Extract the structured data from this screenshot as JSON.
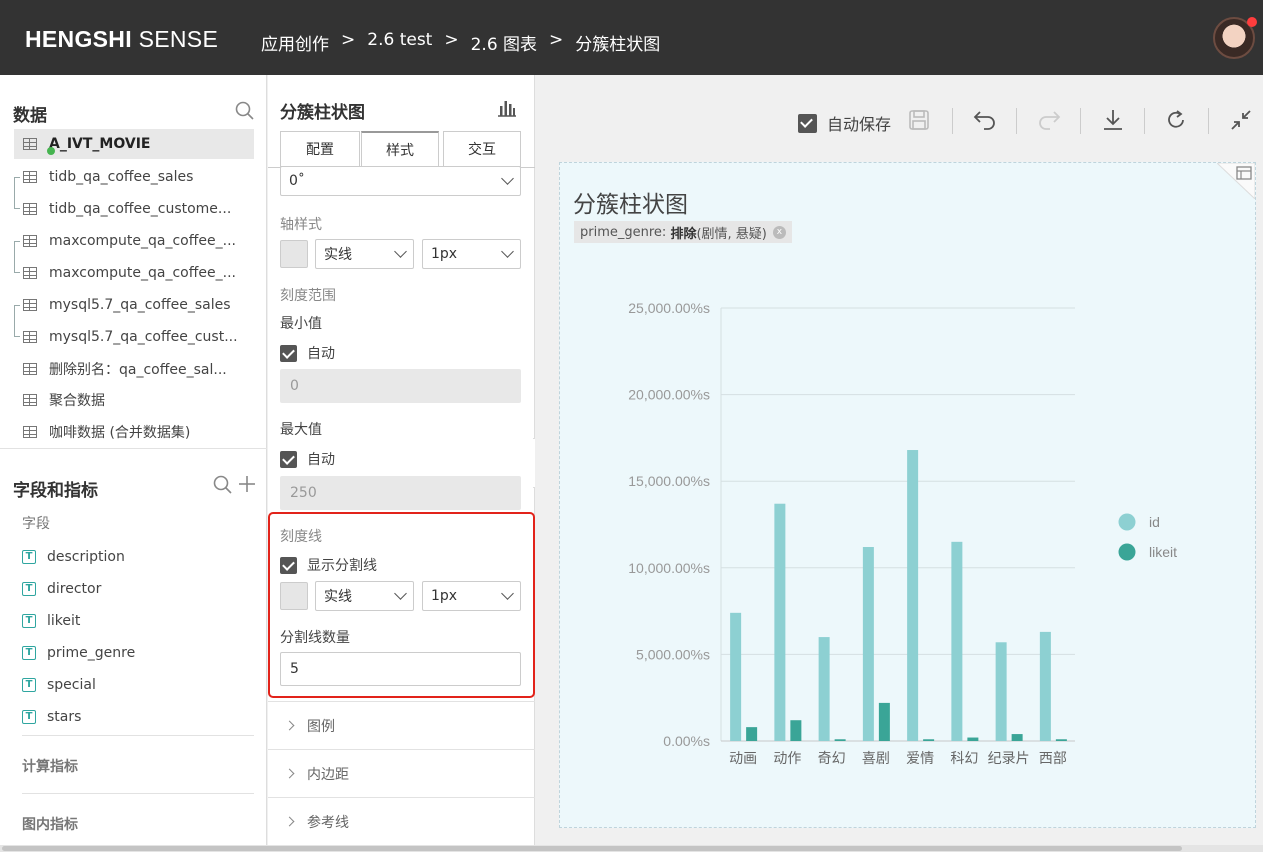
{
  "header": {
    "brand_bold": "HENGSHI",
    "brand_rest": "SENSE",
    "breadcrumbs": [
      "应用创作",
      "2.6 test",
      "2.6 图表",
      "分簇柱状图"
    ],
    "separator": ">"
  },
  "data_panel": {
    "title": "数据",
    "datasets": [
      "A_IVT_MOVIE",
      "tidb_qa_coffee_sales",
      "tidb_qa_coffee_custome...",
      "maxcompute_qa_coffee_...",
      "maxcompute_qa_coffee_...",
      "mysql5.7_qa_coffee_sales",
      "mysql5.7_qa_coffee_cust...",
      "删除别名：qa_coffee_sal...",
      "聚合数据",
      "咖啡数据 (合并数据集)"
    ]
  },
  "fields_panel": {
    "title": "字段和指标",
    "fields_label": "字段",
    "fields": [
      "description",
      "director",
      "likeit",
      "prime_genre",
      "special",
      "stars"
    ],
    "field_type_glyph": "T",
    "calc_label": "计算指标",
    "inner_label": "图内指标"
  },
  "settings": {
    "title": "分簇柱状图",
    "tabs": [
      "配置",
      "样式",
      "交互"
    ],
    "active_tab": "样式",
    "angle_value": "0˚",
    "axis_style_label": "轴样式",
    "axis_line_type": "实线",
    "axis_line_width": "1px",
    "scale_range_label": "刻度范围",
    "min_label": "最小值",
    "auto_label": "自动",
    "min_value": "0",
    "max_label": "最大值",
    "max_value": "250",
    "tick_line_label": "刻度线",
    "show_split_label": "显示分割线",
    "split_line_type": "实线",
    "split_line_width": "1px",
    "split_count_label": "分割线数量",
    "split_count": "5",
    "accordion": [
      "图例",
      "内边距",
      "参考线"
    ]
  },
  "toolbar": {
    "autosave_label": "自动保存"
  },
  "chart": {
    "filter_field": "prime_genre:",
    "filter_op": "排除",
    "filter_values": "(剧情, 悬疑)",
    "filter_remove": "x"
  },
  "chart_data": {
    "type": "bar",
    "title": "分簇柱状图",
    "categories": [
      "动画",
      "动作",
      "奇幻",
      "喜剧",
      "爱情",
      "科幻",
      "纪录片",
      "西部"
    ],
    "series": [
      {
        "name": "id",
        "color": "#8dd0d2",
        "values": [
          7400,
          13700,
          6000,
          11200,
          16800,
          11500,
          5700,
          6300
        ]
      },
      {
        "name": "likeit",
        "color": "#3aa597",
        "values": [
          800,
          1200,
          100,
          2200,
          100,
          200,
          400,
          100
        ]
      }
    ],
    "y_ticks": [
      "0.00%s",
      "5,000.00%s",
      "10,000.00%s",
      "15,000.00%s",
      "20,000.00%s",
      "25,000.00%s"
    ],
    "ylim": [
      0,
      25000
    ],
    "grid": true,
    "legend_position": "right"
  }
}
